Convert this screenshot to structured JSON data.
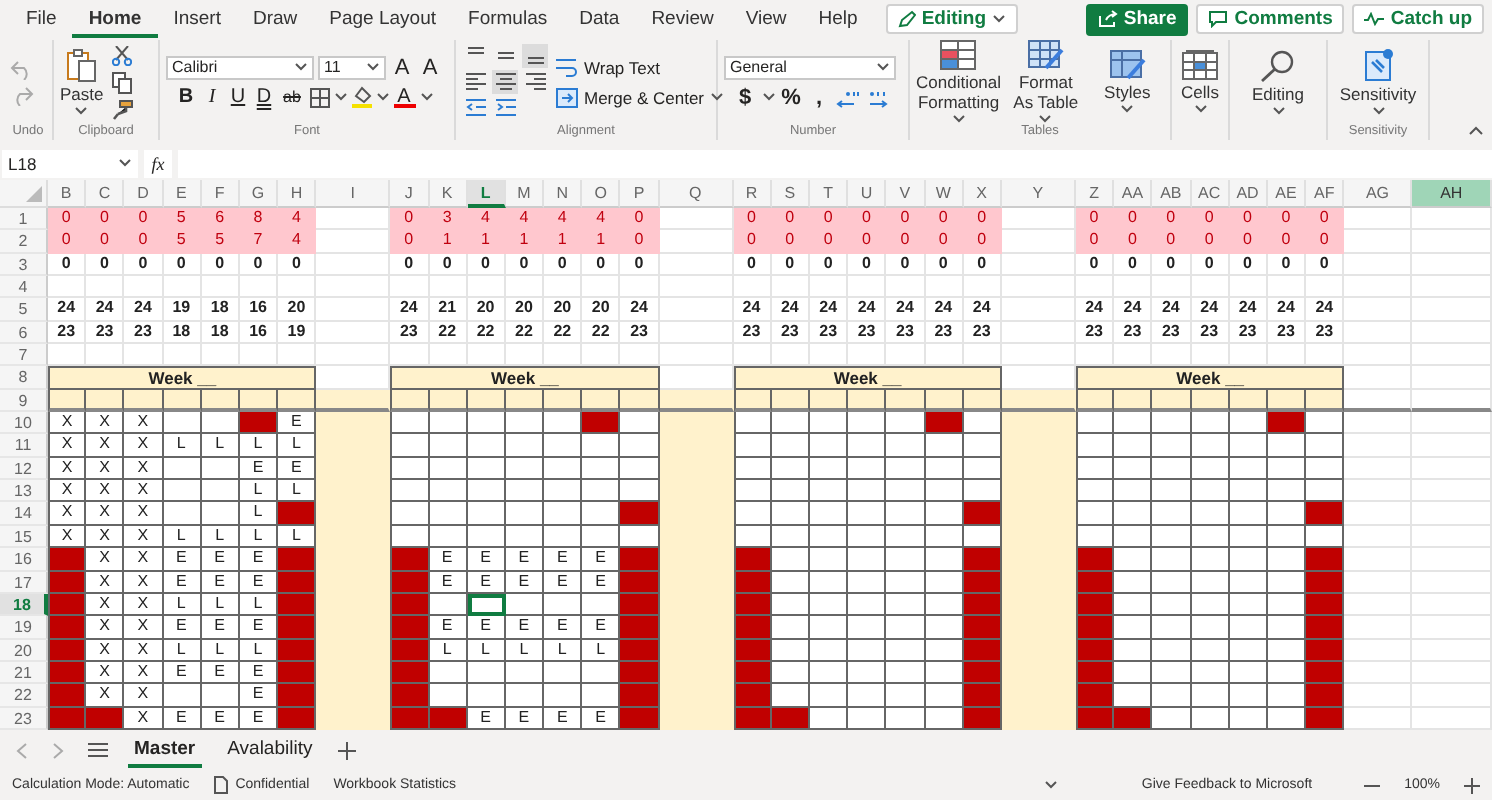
{
  "menu": {
    "tabs": [
      {
        "label": "File",
        "selected": false
      },
      {
        "label": "Home",
        "selected": true
      },
      {
        "label": "Insert",
        "selected": false
      },
      {
        "label": "Draw",
        "selected": false
      },
      {
        "label": "Page Layout",
        "selected": false
      },
      {
        "label": "Formulas",
        "selected": false
      },
      {
        "label": "Data",
        "selected": false
      },
      {
        "label": "Review",
        "selected": false
      },
      {
        "label": "View",
        "selected": false
      },
      {
        "label": "Help",
        "selected": false
      }
    ],
    "mode": "Editing",
    "share": "Share",
    "comments": "Comments",
    "catch_up": "Catch up"
  },
  "ribbon": {
    "groups": [
      {
        "kind": "undo",
        "label": "Undo"
      },
      {
        "kind": "clipboard",
        "label": "Clipboard",
        "paste": "Paste"
      },
      {
        "kind": "font",
        "label": "Font",
        "font": "Calibri",
        "size": "11",
        "size_buttons": [
          "A",
          "A"
        ],
        "styles": [
          "B",
          "I",
          "U",
          "D",
          "ab"
        ],
        "font_color": "A"
      },
      {
        "kind": "alignment",
        "label": "Alignment",
        "align_buttons": [
          {
            "kind": "top",
            "selected": false
          },
          {
            "kind": "middle",
            "selected": false
          },
          {
            "kind": "bottom",
            "selected": true
          },
          {
            "kind": "left",
            "selected": false
          },
          {
            "kind": "center",
            "selected": true
          },
          {
            "kind": "right",
            "selected": false
          },
          {
            "kind": "outdent",
            "selected": false
          },
          {
            "kind": "indent",
            "selected": false
          }
        ],
        "wrap": "Wrap Text",
        "merge": "Merge & Center"
      },
      {
        "kind": "number",
        "label": "Number",
        "format": "General",
        "symbols": [
          "$",
          "%",
          ","
        ]
      },
      {
        "kind": "tables",
        "label": "Tables",
        "buttons": [
          "Conditional Formatting",
          "Format As Table",
          "Styles"
        ]
      },
      {
        "kind": "cells",
        "buttons": [
          "Cells"
        ]
      },
      {
        "kind": "editing",
        "buttons": [
          "Editing"
        ]
      },
      {
        "kind": "sensitivity",
        "label": "Sensitivity",
        "buttons": [
          "Sensitivity"
        ]
      }
    ]
  },
  "formula_bar": {
    "name_box": "L18",
    "fx": "fx"
  },
  "columns": [
    {
      "label": "B",
      "active": false,
      "selected": false
    },
    {
      "label": "C",
      "active": false,
      "selected": false
    },
    {
      "label": "D",
      "active": false,
      "selected": false
    },
    {
      "label": "E",
      "active": false,
      "selected": false
    },
    {
      "label": "F",
      "active": false,
      "selected": false
    },
    {
      "label": "G",
      "active": false,
      "selected": false
    },
    {
      "label": "H",
      "active": false,
      "selected": false
    },
    {
      "label": "I",
      "active": false,
      "selected": false
    },
    {
      "label": "J",
      "active": false,
      "selected": false
    },
    {
      "label": "K",
      "active": false,
      "selected": false
    },
    {
      "label": "L",
      "active": true,
      "selected": false
    },
    {
      "label": "M",
      "active": false,
      "selected": false
    },
    {
      "label": "N",
      "active": false,
      "selected": false
    },
    {
      "label": "O",
      "active": false,
      "selected": false
    },
    {
      "label": "P",
      "active": false,
      "selected": false
    },
    {
      "label": "Q",
      "active": false,
      "selected": false
    },
    {
      "label": "R",
      "active": false,
      "selected": false
    },
    {
      "label": "S",
      "active": false,
      "selected": false
    },
    {
      "label": "T",
      "active": false,
      "selected": false
    },
    {
      "label": "U",
      "active": false,
      "selected": false
    },
    {
      "label": "V",
      "active": false,
      "selected": false
    },
    {
      "label": "W",
      "active": false,
      "selected": false
    },
    {
      "label": "X",
      "active": false,
      "selected": false
    },
    {
      "label": "Y",
      "active": false,
      "selected": false
    },
    {
      "label": "Z",
      "active": false,
      "selected": false
    },
    {
      "label": "AA",
      "active": false,
      "selected": false
    },
    {
      "label": "AB",
      "active": false,
      "selected": false
    },
    {
      "label": "AC",
      "active": false,
      "selected": false
    },
    {
      "label": "AD",
      "active": false,
      "selected": false
    },
    {
      "label": "AE",
      "active": false,
      "selected": false
    },
    {
      "label": "AF",
      "active": false,
      "selected": false
    },
    {
      "label": "AG",
      "active": false,
      "selected": false
    },
    {
      "label": "AH",
      "active": false,
      "selected": true
    }
  ],
  "rows": [
    {
      "label": "1",
      "active": false
    },
    {
      "label": "2",
      "active": false
    },
    {
      "label": "3",
      "active": false
    },
    {
      "label": "4",
      "active": false
    },
    {
      "label": "5",
      "active": false
    },
    {
      "label": "6",
      "active": false
    },
    {
      "label": "7",
      "active": false
    },
    {
      "label": "8",
      "active": false
    },
    {
      "label": "9",
      "active": false
    },
    {
      "label": "10",
      "active": false
    },
    {
      "label": "11",
      "active": false
    },
    {
      "label": "12",
      "active": false
    },
    {
      "label": "13",
      "active": false
    },
    {
      "label": "14",
      "active": false
    },
    {
      "label": "15",
      "active": false
    },
    {
      "label": "16",
      "active": false
    },
    {
      "label": "17",
      "active": false
    },
    {
      "label": "18",
      "active": true
    },
    {
      "label": "19",
      "active": false
    },
    {
      "label": "20",
      "active": false
    },
    {
      "label": "21",
      "active": false
    },
    {
      "label": "22",
      "active": false
    },
    {
      "label": "23",
      "active": false
    }
  ],
  "weeks": [
    {
      "title": "Week __",
      "summary": [
        {
          "kind": "flagged",
          "cells": [
            "0",
            "0",
            "0",
            "5",
            "6",
            "8",
            "4"
          ]
        },
        {
          "kind": "flagged",
          "cells": [
            "0",
            "0",
            "0",
            "5",
            "5",
            "7",
            "4"
          ]
        },
        {
          "kind": "plain",
          "cells": [
            "0",
            "0",
            "0",
            "0",
            "0",
            "0",
            "0"
          ]
        },
        {
          "kind": "blank"
        },
        {
          "kind": "plain",
          "cells": [
            "24",
            "24",
            "24",
            "19",
            "18",
            "16",
            "20"
          ]
        },
        {
          "kind": "plain",
          "cells": [
            "23",
            "23",
            "23",
            "18",
            "18",
            "16",
            "19"
          ]
        },
        {
          "kind": "blank"
        }
      ],
      "days": [
        {
          "cells": [
            "X",
            "X",
            "X",
            null,
            null,
            null,
            "E"
          ],
          "filled": [
            false,
            false,
            false,
            false,
            false,
            true,
            false
          ]
        },
        {
          "cells": [
            "X",
            "X",
            "X",
            "L",
            "L",
            "L",
            "L"
          ],
          "filled": [
            false,
            false,
            false,
            false,
            false,
            false,
            false
          ]
        },
        {
          "cells": [
            "X",
            "X",
            "X",
            null,
            null,
            "E",
            "E"
          ],
          "filled": [
            false,
            false,
            false,
            false,
            false,
            false,
            false
          ]
        },
        {
          "cells": [
            "X",
            "X",
            "X",
            null,
            null,
            "L",
            "L"
          ],
          "filled": [
            false,
            false,
            false,
            false,
            false,
            false,
            false
          ]
        },
        {
          "cells": [
            "X",
            "X",
            "X",
            null,
            null,
            "L",
            null
          ],
          "filled": [
            false,
            false,
            false,
            false,
            false,
            false,
            true
          ]
        },
        {
          "cells": [
            "X",
            "X",
            "X",
            "L",
            "L",
            "L",
            "L"
          ],
          "filled": [
            false,
            false,
            false,
            false,
            false,
            false,
            false
          ]
        },
        {
          "cells": [
            null,
            "X",
            "X",
            "E",
            "E",
            "E",
            null
          ],
          "filled": [
            true,
            false,
            false,
            false,
            false,
            false,
            true
          ]
        },
        {
          "cells": [
            null,
            "X",
            "X",
            "E",
            "E",
            "E",
            null
          ],
          "filled": [
            true,
            false,
            false,
            false,
            false,
            false,
            true
          ]
        },
        {
          "cells": [
            null,
            "X",
            "X",
            "L",
            "L",
            "L",
            null
          ],
          "filled": [
            true,
            false,
            false,
            false,
            false,
            false,
            true
          ]
        },
        {
          "cells": [
            null,
            "X",
            "X",
            "E",
            "E",
            "E",
            null
          ],
          "filled": [
            true,
            false,
            false,
            false,
            false,
            false,
            true
          ]
        },
        {
          "cells": [
            null,
            "X",
            "X",
            "L",
            "L",
            "L",
            null
          ],
          "filled": [
            true,
            false,
            false,
            false,
            false,
            false,
            true
          ]
        },
        {
          "cells": [
            null,
            "X",
            "X",
            "E",
            "E",
            "E",
            null
          ],
          "filled": [
            true,
            false,
            false,
            false,
            false,
            false,
            true
          ]
        },
        {
          "cells": [
            null,
            "X",
            "X",
            null,
            null,
            "E",
            null
          ],
          "filled": [
            true,
            false,
            false,
            false,
            false,
            false,
            true
          ]
        },
        {
          "cells": [
            null,
            null,
            "X",
            "E",
            "E",
            "E",
            null
          ],
          "filled": [
            true,
            true,
            false,
            false,
            false,
            false,
            true
          ]
        }
      ]
    },
    {
      "title": "Week __",
      "summary": [
        {
          "kind": "flagged",
          "cells": [
            "0",
            "3",
            "4",
            "4",
            "4",
            "4",
            "0"
          ]
        },
        {
          "kind": "flagged",
          "cells": [
            "0",
            "1",
            "1",
            "1",
            "1",
            "1",
            "0"
          ]
        },
        {
          "kind": "plain",
          "cells": [
            "0",
            "0",
            "0",
            "0",
            "0",
            "0",
            "0"
          ]
        },
        {
          "kind": "blank"
        },
        {
          "kind": "plain",
          "cells": [
            "24",
            "21",
            "20",
            "20",
            "20",
            "20",
            "24"
          ]
        },
        {
          "kind": "plain",
          "cells": [
            "23",
            "22",
            "22",
            "22",
            "22",
            "22",
            "23"
          ]
        },
        {
          "kind": "blank"
        }
      ],
      "days": [
        {
          "filled": [
            false,
            false,
            false,
            false,
            false,
            true,
            false
          ]
        },
        {
          "filled": [
            false,
            false,
            false,
            false,
            false,
            false,
            false
          ]
        },
        {
          "filled": [
            false,
            false,
            false,
            false,
            false,
            false,
            false
          ]
        },
        {
          "filled": [
            false,
            false,
            false,
            false,
            false,
            false,
            false
          ]
        },
        {
          "filled": [
            false,
            false,
            false,
            false,
            false,
            false,
            true
          ]
        },
        {
          "filled": [
            false,
            false,
            false,
            false,
            false,
            false,
            false
          ]
        },
        {
          "cells": [
            null,
            "E",
            "E",
            "E",
            "E",
            "E",
            null
          ],
          "filled": [
            true,
            false,
            false,
            false,
            false,
            false,
            true
          ]
        },
        {
          "cells": [
            null,
            "E",
            "E",
            "E",
            "E",
            "E",
            null
          ],
          "filled": [
            true,
            false,
            false,
            false,
            false,
            false,
            true
          ]
        },
        {
          "filled": [
            true,
            false,
            false,
            false,
            false,
            false,
            true
          ]
        },
        {
          "cells": [
            null,
            "E",
            "E",
            "E",
            "E",
            "E",
            null
          ],
          "filled": [
            true,
            false,
            false,
            false,
            false,
            false,
            true
          ]
        },
        {
          "cells": [
            null,
            "L",
            "L",
            "L",
            "L",
            "L",
            null
          ],
          "filled": [
            true,
            false,
            false,
            false,
            false,
            false,
            true
          ]
        },
        {
          "filled": [
            true,
            false,
            false,
            false,
            false,
            false,
            true
          ]
        },
        {
          "filled": [
            true,
            false,
            false,
            false,
            false,
            false,
            true
          ]
        },
        {
          "cells": [
            null,
            null,
            "E",
            "E",
            "E",
            "E",
            null
          ],
          "filled": [
            true,
            true,
            false,
            false,
            false,
            false,
            true
          ]
        }
      ]
    },
    {
      "title": "Week __",
      "summary": [
        {
          "kind": "flagged",
          "cells": [
            "0",
            "0",
            "0",
            "0",
            "0",
            "0",
            "0"
          ]
        },
        {
          "kind": "flagged",
          "cells": [
            "0",
            "0",
            "0",
            "0",
            "0",
            "0",
            "0"
          ]
        },
        {
          "kind": "plain",
          "cells": [
            "0",
            "0",
            "0",
            "0",
            "0",
            "0",
            "0"
          ]
        },
        {
          "kind": "blank"
        },
        {
          "kind": "plain",
          "cells": [
            "24",
            "24",
            "24",
            "24",
            "24",
            "24",
            "24"
          ]
        },
        {
          "kind": "plain",
          "cells": [
            "23",
            "23",
            "23",
            "23",
            "23",
            "23",
            "23"
          ]
        },
        {
          "kind": "blank"
        }
      ],
      "days": [
        {
          "filled": [
            false,
            false,
            false,
            false,
            false,
            true,
            false
          ]
        },
        {
          "filled": [
            false,
            false,
            false,
            false,
            false,
            false,
            false
          ]
        },
        {
          "filled": [
            false,
            false,
            false,
            false,
            false,
            false,
            false
          ]
        },
        {
          "filled": [
            false,
            false,
            false,
            false,
            false,
            false,
            false
          ]
        },
        {
          "filled": [
            false,
            false,
            false,
            false,
            false,
            false,
            true
          ]
        },
        {
          "filled": [
            false,
            false,
            false,
            false,
            false,
            false,
            false
          ]
        },
        {
          "filled": [
            true,
            false,
            false,
            false,
            false,
            false,
            true
          ]
        },
        {
          "filled": [
            true,
            false,
            false,
            false,
            false,
            false,
            true
          ]
        },
        {
          "filled": [
            true,
            false,
            false,
            false,
            false,
            false,
            true
          ]
        },
        {
          "filled": [
            true,
            false,
            false,
            false,
            false,
            false,
            true
          ]
        },
        {
          "filled": [
            true,
            false,
            false,
            false,
            false,
            false,
            true
          ]
        },
        {
          "filled": [
            true,
            false,
            false,
            false,
            false,
            false,
            true
          ]
        },
        {
          "filled": [
            true,
            false,
            false,
            false,
            false,
            false,
            true
          ]
        },
        {
          "filled": [
            true,
            true,
            false,
            false,
            false,
            false,
            true
          ]
        }
      ]
    },
    {
      "title": "Week __",
      "summary": [
        {
          "kind": "flagged",
          "cells": [
            "0",
            "0",
            "0",
            "0",
            "0",
            "0",
            "0"
          ]
        },
        {
          "kind": "flagged",
          "cells": [
            "0",
            "0",
            "0",
            "0",
            "0",
            "0",
            "0"
          ]
        },
        {
          "kind": "plain",
          "cells": [
            "0",
            "0",
            "0",
            "0",
            "0",
            "0",
            "0"
          ]
        },
        {
          "kind": "blank"
        },
        {
          "kind": "plain",
          "cells": [
            "24",
            "24",
            "24",
            "24",
            "24",
            "24",
            "24"
          ]
        },
        {
          "kind": "plain",
          "cells": [
            "23",
            "23",
            "23",
            "23",
            "23",
            "23",
            "23"
          ]
        },
        {
          "kind": "blank"
        }
      ],
      "days": [
        {
          "filled": [
            false,
            false,
            false,
            false,
            false,
            true,
            false
          ]
        },
        {
          "filled": [
            false,
            false,
            false,
            false,
            false,
            false,
            false
          ]
        },
        {
          "filled": [
            false,
            false,
            false,
            false,
            false,
            false,
            false
          ]
        },
        {
          "filled": [
            false,
            false,
            false,
            false,
            false,
            false,
            false
          ]
        },
        {
          "filled": [
            false,
            false,
            false,
            false,
            false,
            false,
            true
          ]
        },
        {
          "filled": [
            false,
            false,
            false,
            false,
            false,
            false,
            false
          ]
        },
        {
          "filled": [
            true,
            false,
            false,
            false,
            false,
            false,
            true
          ]
        },
        {
          "filled": [
            true,
            false,
            false,
            false,
            false,
            false,
            true
          ]
        },
        {
          "filled": [
            true,
            false,
            false,
            false,
            false,
            false,
            true
          ]
        },
        {
          "filled": [
            true,
            false,
            false,
            false,
            false,
            false,
            true
          ]
        },
        {
          "filled": [
            true,
            false,
            false,
            false,
            false,
            false,
            true
          ]
        },
        {
          "filled": [
            true,
            false,
            false,
            false,
            false,
            false,
            true
          ]
        },
        {
          "filled": [
            true,
            false,
            false,
            false,
            false,
            false,
            true
          ]
        },
        {
          "filled": [
            true,
            true,
            false,
            false,
            false,
            false,
            true
          ]
        }
      ]
    }
  ],
  "sheet_tabs": [
    {
      "label": "Master",
      "selected": true
    },
    {
      "label": "Avalability",
      "selected": false
    }
  ],
  "status_bar": {
    "calculation": "Calculation Mode: Automatic",
    "sensitivity": "Confidential",
    "statistics": "Workbook Statistics",
    "feedback": "Give Feedback to Microsoft",
    "zoom": "100%"
  }
}
